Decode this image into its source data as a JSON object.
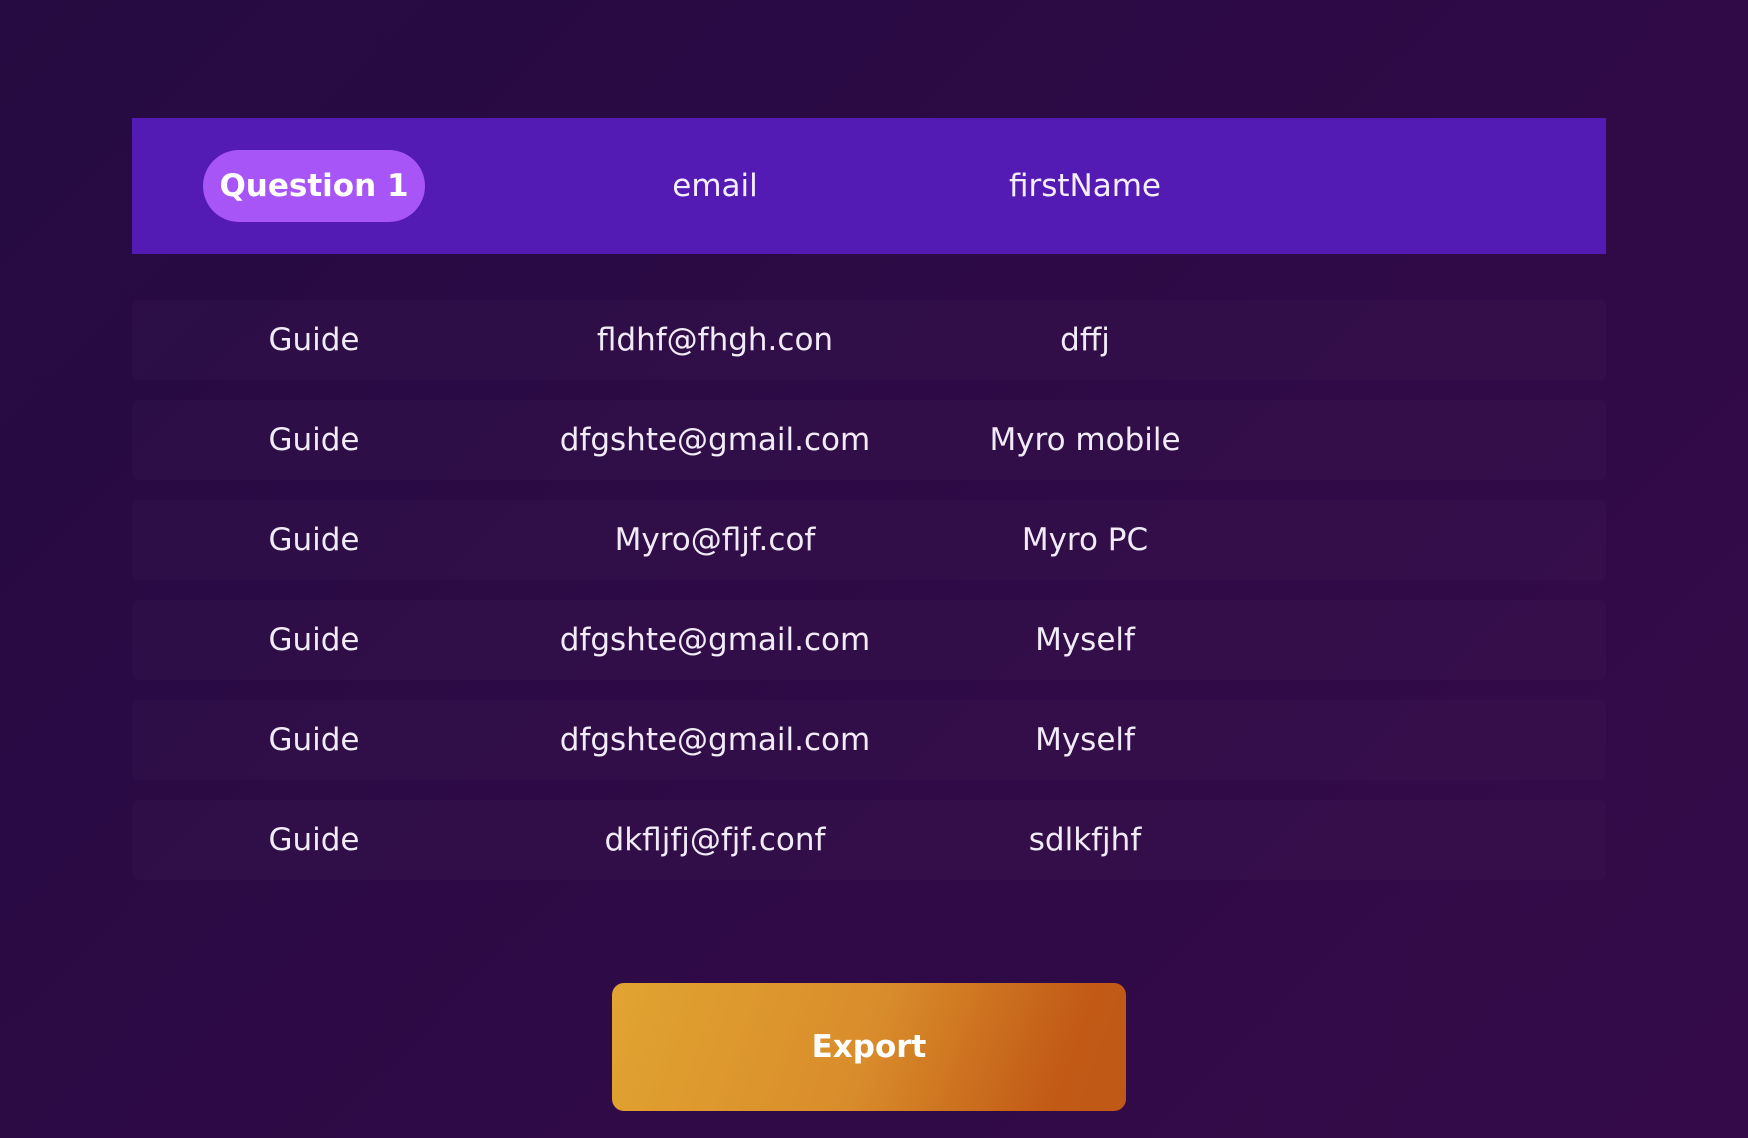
{
  "table": {
    "headers": {
      "question": "Question 1",
      "email": "email",
      "first_name": "firstName"
    },
    "rows": [
      {
        "question": "Guide",
        "email": "fldhf@fhgh.con",
        "first_name": "dffj"
      },
      {
        "question": "Guide",
        "email": "dfgshte@gmail.com",
        "first_name": "Myro mobile"
      },
      {
        "question": "Guide",
        "email": "Myro@fljf.cof",
        "first_name": "Myro PC"
      },
      {
        "question": "Guide",
        "email": "dfgshte@gmail.com",
        "first_name": "Myself"
      },
      {
        "question": "Guide",
        "email": "dfgshte@gmail.com",
        "first_name": "Myself"
      },
      {
        "question": "Guide",
        "email": "dkfljfj@fjf.conf",
        "first_name": "sdlkfjhf"
      }
    ]
  },
  "actions": {
    "export_label": "Export"
  },
  "colors": {
    "header_background": "#541ab4",
    "active_pill": "#a855f7",
    "page_background": "#2d0a45",
    "export_gradient_start": "#e1a431",
    "export_gradient_end": "#bf5716"
  }
}
